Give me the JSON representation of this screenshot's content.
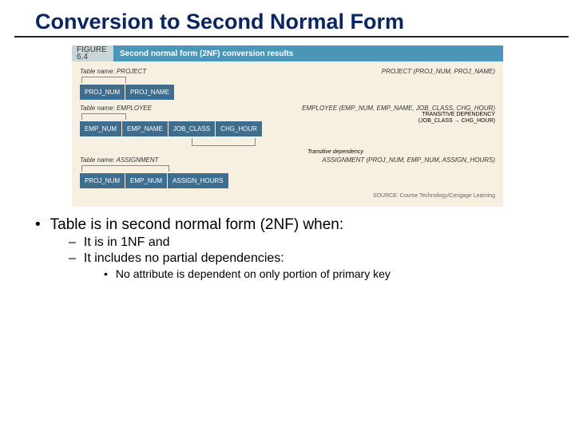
{
  "title": "Conversion to Second Normal Form",
  "figure": {
    "label_line1": "FIGURE",
    "label_line2": "6.4",
    "caption": "Second normal form (2NF) conversion results",
    "source": "SOURCE: Course Technology/Cengage Learning"
  },
  "tables": {
    "project": {
      "name_label": "Table name: PROJECT",
      "rel": "PROJECT (PROJ_NUM, PROJ_NAME)",
      "attrs": [
        "PROJ_NUM",
        "PROJ_NAME"
      ]
    },
    "employee": {
      "name_label": "Table name: EMPLOYEE",
      "rel": "EMPLOYEE (EMP_NUM, EMP_NAME, JOB_CLASS, CHG_HOUR)",
      "attrs": [
        "EMP_NUM",
        "EMP_NAME",
        "JOB_CLASS",
        "CHG_HOUR"
      ],
      "trans_dep_label": "TRANSITIVE DEPENDENCY",
      "trans_dep_detail": "(JOB_CLASS → CHG_HOUR)",
      "trans_note": "Transitive dependency"
    },
    "assignment": {
      "name_label": "Table name: ASSIGNMENT",
      "rel": "ASSIGNMENT (PROJ_NUM, EMP_NUM, ASSIGN_HOURS)",
      "attrs": [
        "PROJ_NUM",
        "EMP_NUM",
        "ASSIGN_HOURS"
      ]
    }
  },
  "bullets": {
    "b1": "Table is in second normal form (2NF) when:",
    "b2a": "It is in 1NF and",
    "b2b": "It includes no partial dependencies:",
    "b3": "No attribute is dependent on only portion of primary key"
  }
}
